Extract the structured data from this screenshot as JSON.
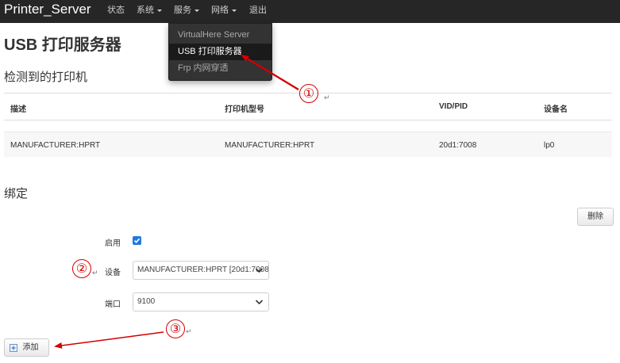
{
  "navbar": {
    "brand": "Printer_Server",
    "items": [
      {
        "label": "状态",
        "has_caret": false
      },
      {
        "label": "系统",
        "has_caret": true
      },
      {
        "label": "服务",
        "has_caret": true
      },
      {
        "label": "网络",
        "has_caret": true
      },
      {
        "label": "退出",
        "has_caret": false
      }
    ]
  },
  "dropdown": {
    "items": [
      {
        "label": "VirtualHere Server",
        "active": false
      },
      {
        "label": "USB 打印服务器",
        "active": true
      },
      {
        "label": "Frp 内网穿透",
        "active": false
      }
    ]
  },
  "page": {
    "title": "USB 打印服务器",
    "detected_section": "检测到的打印机",
    "binding_section": "绑定"
  },
  "printers_table": {
    "columns": [
      "描述",
      "打印机型号",
      "VID/PID",
      "设备名"
    ],
    "rows": [
      [
        "MANUFACTURER:HPRT",
        "MANUFACTURER:HPRT",
        "20d1:7008",
        "lp0"
      ]
    ]
  },
  "binding": {
    "delete_label": "删除",
    "enable_label": "启用",
    "enabled": true,
    "device_label": "设备",
    "device_value": "MANUFACTURER:HPRT [20d1:7008]",
    "port_label": "端口",
    "port_value": "9100",
    "add_label": "添加"
  },
  "annotations": {
    "step1": "①",
    "step2": "②",
    "step3": "③",
    "color": "#d10000"
  }
}
